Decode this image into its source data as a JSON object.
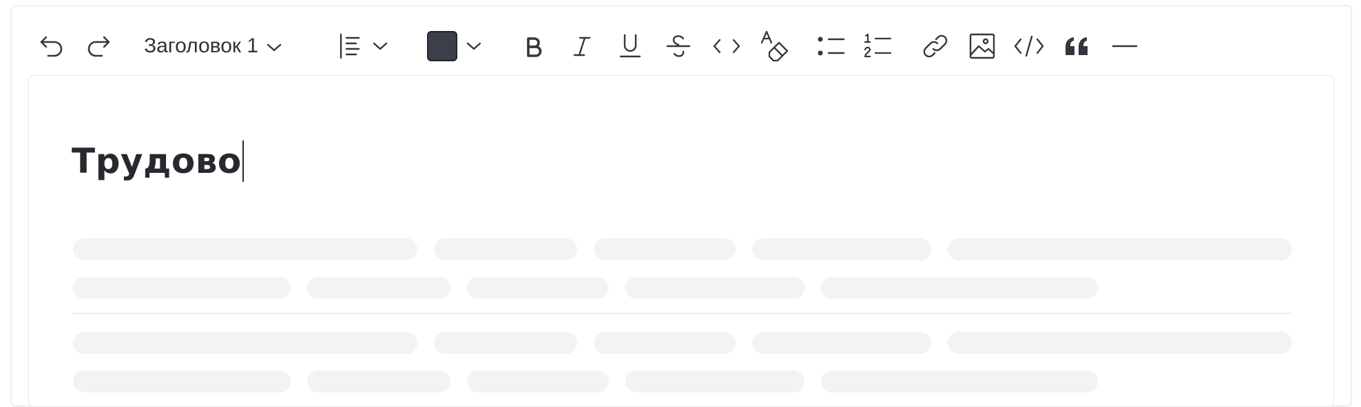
{
  "toolbar": {
    "undo_icon": "undo-icon",
    "redo_icon": "redo-icon",
    "heading_select": {
      "value": "Заголовок 1"
    },
    "align_icon": "align-left-icon",
    "text_color": "#3a3f4a",
    "buttons": [
      "bold-icon",
      "italic-icon",
      "underline-icon",
      "strikethrough-icon",
      "code-icon",
      "clear-format-icon",
      "bullet-list-icon",
      "numbered-list-icon",
      "link-icon",
      "image-icon",
      "code-block-icon",
      "quote-icon",
      "horizontal-rule-icon"
    ]
  },
  "editor": {
    "title": "Трудово"
  },
  "colors": {
    "skeleton": "#f3f3f4",
    "text": "#26292e",
    "border": "#e3e4e7"
  }
}
